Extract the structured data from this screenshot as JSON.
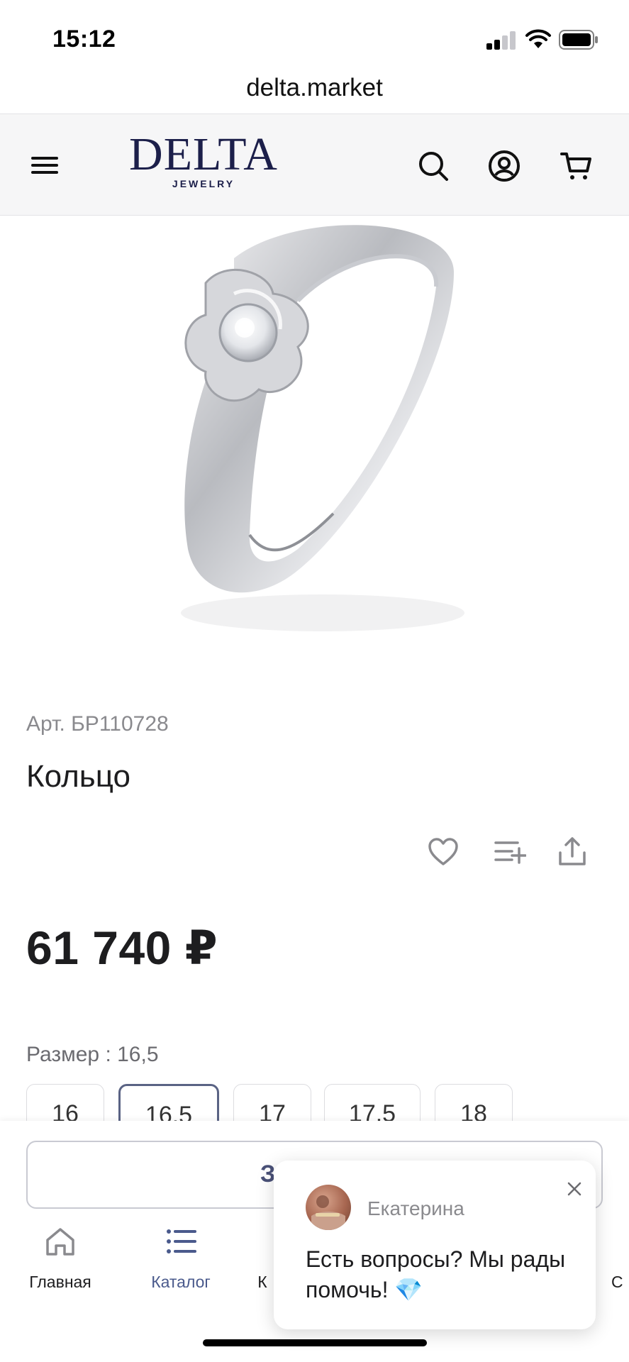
{
  "status_bar": {
    "time": "15:12"
  },
  "browser": {
    "url": "delta.market"
  },
  "header": {
    "logo_main": "DELTA",
    "logo_sub": "JEWELRY",
    "icons": [
      "menu-icon",
      "search-icon",
      "account-icon",
      "cart-icon"
    ]
  },
  "product": {
    "article": "Арт. БР110728",
    "name": "Кольцо",
    "price": "61 740 ₽",
    "size_label": "Размер : 16,5",
    "sizes": [
      "16",
      "16.5",
      "17",
      "17.5",
      "18"
    ],
    "selected_size": "16.5",
    "actions": [
      "heart-icon",
      "add-to-list-icon",
      "share-icon"
    ]
  },
  "cart_button": {
    "label": "З"
  },
  "tabbar": {
    "tabs": [
      {
        "label": "Главная",
        "icon": "home-icon"
      },
      {
        "label": "Каталог",
        "icon": "list-icon"
      },
      {
        "label": "К",
        "icon": ""
      },
      {
        "label": "С",
        "icon": ""
      }
    ],
    "active_tab": "Каталог"
  },
  "chat": {
    "name": "Екатерина",
    "message": "Есть вопросы? Мы рады помочь! 💎"
  },
  "colors": {
    "brand": "#1c1f4a",
    "accent": "#4a5a8c",
    "header_bg": "#f6f6f7"
  }
}
